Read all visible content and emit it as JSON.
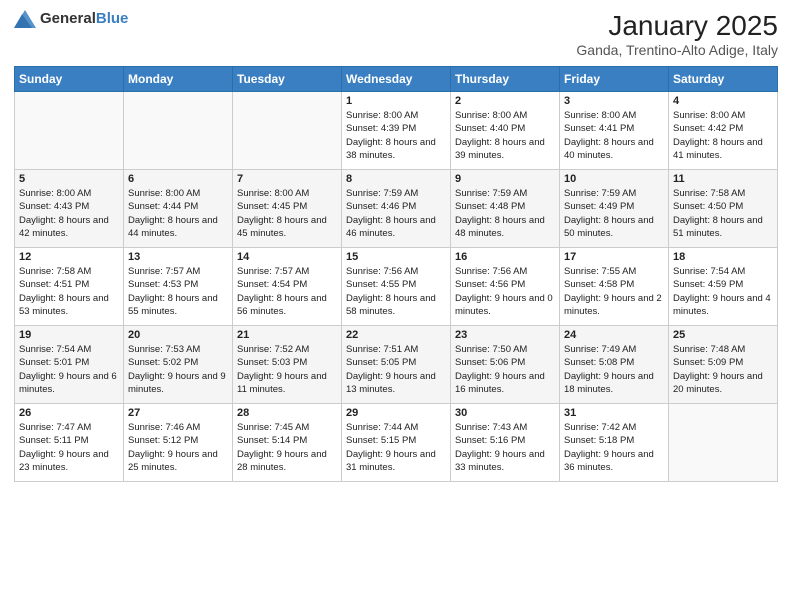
{
  "logo": {
    "general": "General",
    "blue": "Blue"
  },
  "title": "January 2025",
  "subtitle": "Ganda, Trentino-Alto Adige, Italy",
  "days_of_week": [
    "Sunday",
    "Monday",
    "Tuesday",
    "Wednesday",
    "Thursday",
    "Friday",
    "Saturday"
  ],
  "weeks": [
    [
      {
        "day": "",
        "sunrise": "",
        "sunset": "",
        "daylight": ""
      },
      {
        "day": "",
        "sunrise": "",
        "sunset": "",
        "daylight": ""
      },
      {
        "day": "",
        "sunrise": "",
        "sunset": "",
        "daylight": ""
      },
      {
        "day": "1",
        "sunrise": "Sunrise: 8:00 AM",
        "sunset": "Sunset: 4:39 PM",
        "daylight": "Daylight: 8 hours and 38 minutes."
      },
      {
        "day": "2",
        "sunrise": "Sunrise: 8:00 AM",
        "sunset": "Sunset: 4:40 PM",
        "daylight": "Daylight: 8 hours and 39 minutes."
      },
      {
        "day": "3",
        "sunrise": "Sunrise: 8:00 AM",
        "sunset": "Sunset: 4:41 PM",
        "daylight": "Daylight: 8 hours and 40 minutes."
      },
      {
        "day": "4",
        "sunrise": "Sunrise: 8:00 AM",
        "sunset": "Sunset: 4:42 PM",
        "daylight": "Daylight: 8 hours and 41 minutes."
      }
    ],
    [
      {
        "day": "5",
        "sunrise": "Sunrise: 8:00 AM",
        "sunset": "Sunset: 4:43 PM",
        "daylight": "Daylight: 8 hours and 42 minutes."
      },
      {
        "day": "6",
        "sunrise": "Sunrise: 8:00 AM",
        "sunset": "Sunset: 4:44 PM",
        "daylight": "Daylight: 8 hours and 44 minutes."
      },
      {
        "day": "7",
        "sunrise": "Sunrise: 8:00 AM",
        "sunset": "Sunset: 4:45 PM",
        "daylight": "Daylight: 8 hours and 45 minutes."
      },
      {
        "day": "8",
        "sunrise": "Sunrise: 7:59 AM",
        "sunset": "Sunset: 4:46 PM",
        "daylight": "Daylight: 8 hours and 46 minutes."
      },
      {
        "day": "9",
        "sunrise": "Sunrise: 7:59 AM",
        "sunset": "Sunset: 4:48 PM",
        "daylight": "Daylight: 8 hours and 48 minutes."
      },
      {
        "day": "10",
        "sunrise": "Sunrise: 7:59 AM",
        "sunset": "Sunset: 4:49 PM",
        "daylight": "Daylight: 8 hours and 50 minutes."
      },
      {
        "day": "11",
        "sunrise": "Sunrise: 7:58 AM",
        "sunset": "Sunset: 4:50 PM",
        "daylight": "Daylight: 8 hours and 51 minutes."
      }
    ],
    [
      {
        "day": "12",
        "sunrise": "Sunrise: 7:58 AM",
        "sunset": "Sunset: 4:51 PM",
        "daylight": "Daylight: 8 hours and 53 minutes."
      },
      {
        "day": "13",
        "sunrise": "Sunrise: 7:57 AM",
        "sunset": "Sunset: 4:53 PM",
        "daylight": "Daylight: 8 hours and 55 minutes."
      },
      {
        "day": "14",
        "sunrise": "Sunrise: 7:57 AM",
        "sunset": "Sunset: 4:54 PM",
        "daylight": "Daylight: 8 hours and 56 minutes."
      },
      {
        "day": "15",
        "sunrise": "Sunrise: 7:56 AM",
        "sunset": "Sunset: 4:55 PM",
        "daylight": "Daylight: 8 hours and 58 minutes."
      },
      {
        "day": "16",
        "sunrise": "Sunrise: 7:56 AM",
        "sunset": "Sunset: 4:56 PM",
        "daylight": "Daylight: 9 hours and 0 minutes."
      },
      {
        "day": "17",
        "sunrise": "Sunrise: 7:55 AM",
        "sunset": "Sunset: 4:58 PM",
        "daylight": "Daylight: 9 hours and 2 minutes."
      },
      {
        "day": "18",
        "sunrise": "Sunrise: 7:54 AM",
        "sunset": "Sunset: 4:59 PM",
        "daylight": "Daylight: 9 hours and 4 minutes."
      }
    ],
    [
      {
        "day": "19",
        "sunrise": "Sunrise: 7:54 AM",
        "sunset": "Sunset: 5:01 PM",
        "daylight": "Daylight: 9 hours and 6 minutes."
      },
      {
        "day": "20",
        "sunrise": "Sunrise: 7:53 AM",
        "sunset": "Sunset: 5:02 PM",
        "daylight": "Daylight: 9 hours and 9 minutes."
      },
      {
        "day": "21",
        "sunrise": "Sunrise: 7:52 AM",
        "sunset": "Sunset: 5:03 PM",
        "daylight": "Daylight: 9 hours and 11 minutes."
      },
      {
        "day": "22",
        "sunrise": "Sunrise: 7:51 AM",
        "sunset": "Sunset: 5:05 PM",
        "daylight": "Daylight: 9 hours and 13 minutes."
      },
      {
        "day": "23",
        "sunrise": "Sunrise: 7:50 AM",
        "sunset": "Sunset: 5:06 PM",
        "daylight": "Daylight: 9 hours and 16 minutes."
      },
      {
        "day": "24",
        "sunrise": "Sunrise: 7:49 AM",
        "sunset": "Sunset: 5:08 PM",
        "daylight": "Daylight: 9 hours and 18 minutes."
      },
      {
        "day": "25",
        "sunrise": "Sunrise: 7:48 AM",
        "sunset": "Sunset: 5:09 PM",
        "daylight": "Daylight: 9 hours and 20 minutes."
      }
    ],
    [
      {
        "day": "26",
        "sunrise": "Sunrise: 7:47 AM",
        "sunset": "Sunset: 5:11 PM",
        "daylight": "Daylight: 9 hours and 23 minutes."
      },
      {
        "day": "27",
        "sunrise": "Sunrise: 7:46 AM",
        "sunset": "Sunset: 5:12 PM",
        "daylight": "Daylight: 9 hours and 25 minutes."
      },
      {
        "day": "28",
        "sunrise": "Sunrise: 7:45 AM",
        "sunset": "Sunset: 5:14 PM",
        "daylight": "Daylight: 9 hours and 28 minutes."
      },
      {
        "day": "29",
        "sunrise": "Sunrise: 7:44 AM",
        "sunset": "Sunset: 5:15 PM",
        "daylight": "Daylight: 9 hours and 31 minutes."
      },
      {
        "day": "30",
        "sunrise": "Sunrise: 7:43 AM",
        "sunset": "Sunset: 5:16 PM",
        "daylight": "Daylight: 9 hours and 33 minutes."
      },
      {
        "day": "31",
        "sunrise": "Sunrise: 7:42 AM",
        "sunset": "Sunset: 5:18 PM",
        "daylight": "Daylight: 9 hours and 36 minutes."
      },
      {
        "day": "",
        "sunrise": "",
        "sunset": "",
        "daylight": ""
      }
    ]
  ]
}
